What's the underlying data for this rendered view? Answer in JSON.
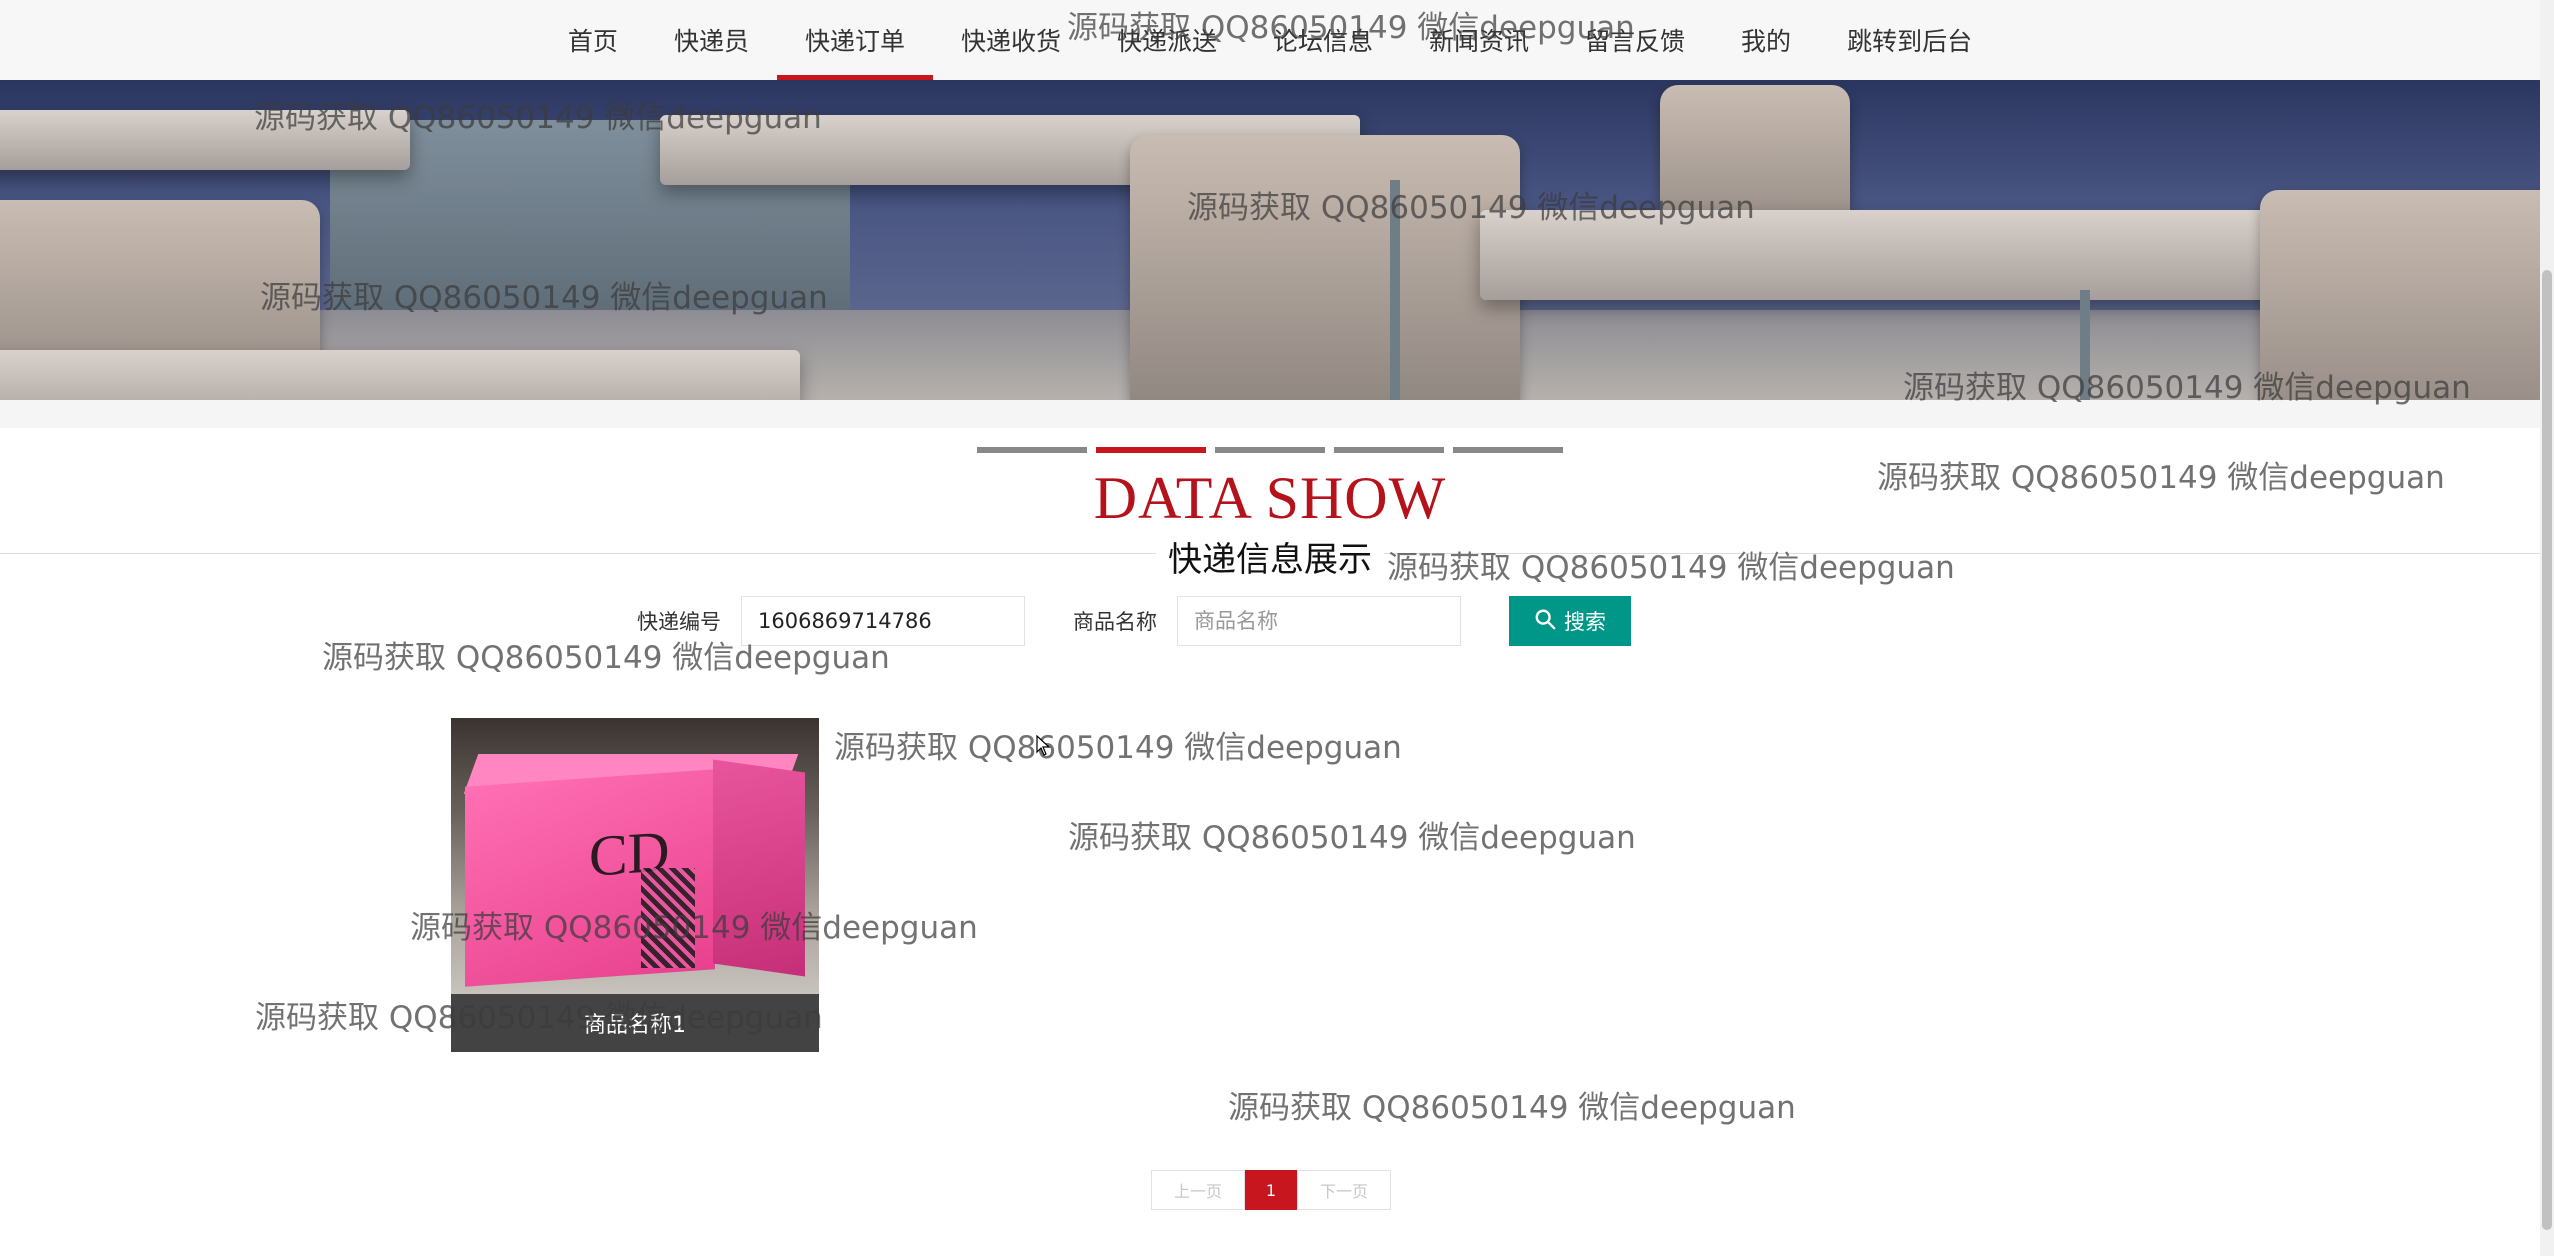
{
  "nav": {
    "items": [
      {
        "label": "首页",
        "active": false
      },
      {
        "label": "快递员",
        "active": false
      },
      {
        "label": "快递订单",
        "active": true
      },
      {
        "label": "快递收货",
        "active": false
      },
      {
        "label": "快递派送",
        "active": false
      },
      {
        "label": "论坛信息",
        "active": false
      },
      {
        "label": "新闻资讯",
        "active": false
      },
      {
        "label": "留言反馈",
        "active": false
      },
      {
        "label": "我的",
        "active": false
      },
      {
        "label": "跳转到后台",
        "active": false
      }
    ],
    "accent_color": "#c8161e"
  },
  "carousel": {
    "slide_count": 5,
    "active_index": 1
  },
  "section": {
    "title": "DATA SHOW",
    "subtitle": "快递信息展示"
  },
  "search": {
    "tracking_label": "快递编号",
    "tracking_value": "1606869714786",
    "product_label": "商品名称",
    "product_placeholder": "商品名称",
    "button_label": "搜索",
    "button_color": "#009688"
  },
  "products": [
    {
      "name": "商品名称1",
      "icon": "package-photo"
    }
  ],
  "pagination": {
    "prev": "上一页",
    "current": "1",
    "next": "下一页"
  },
  "watermark": {
    "text": "源码获取 QQ86050149 微信deepguan"
  }
}
